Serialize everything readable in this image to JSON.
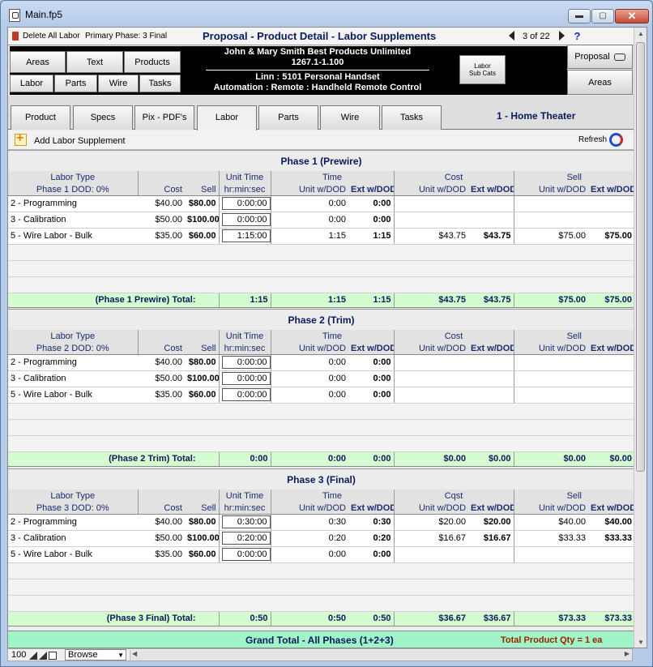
{
  "window": {
    "title": "Main.fp5",
    "min_glyph": "▬",
    "max_glyph": "▢",
    "close_glyph": "✕"
  },
  "topbar": {
    "delete_all": "Delete All Labor",
    "primary_phase": "Primary Phase: 3 Final",
    "page_title": "Proposal - Product Detail - Labor Supplements",
    "record_count": "3 of 22",
    "help": "?"
  },
  "nav": {
    "areas": "Areas",
    "text": "Text",
    "products": "Products",
    "labor": "Labor",
    "parts": "Parts",
    "wire": "Wire",
    "tasks": "Tasks",
    "client_line1": "John & Mary Smith  Best Products Unlimited",
    "client_line2": "1267.1-1.100",
    "product_line1": "Linn : 5101 Personal Handset",
    "product_line2": "Automation : Remote : Handheld Remote Control",
    "subcats_line1": "Labor",
    "subcats_line2": "Sub Cats",
    "proposal": "Proposal",
    "areas_right": "Areas"
  },
  "tabs": [
    {
      "label": "Product"
    },
    {
      "label": "Specs"
    },
    {
      "label": "Pix - PDF's"
    },
    {
      "label": "Labor"
    },
    {
      "label": "Parts"
    },
    {
      "label": "Wire"
    },
    {
      "label": "Tasks"
    }
  ],
  "area_name": "1 - Home Theater",
  "add_supplement": "Add Labor Supplement",
  "refresh": "Refresh",
  "headers": {
    "labor_type": "Labor Type",
    "cost": "Cost",
    "sell": "Sell",
    "unit_time": "Unit Time",
    "hms": "hr:min:sec",
    "time": "Time",
    "unit_dod": "Unit w/DOD",
    "ext_dod": "Ext w/DOD",
    "cost_group": "Cost",
    "sell_group": "Sell"
  },
  "phases": [
    {
      "title": "Phase 1 (Prewire)",
      "dod": "Phase 1 DOD: 0%",
      "cost_group": "Cost",
      "rows": [
        {
          "type": "2 - Programming",
          "cost": "$40.00",
          "sell": "$80.00",
          "unit_time": "0:00:00",
          "time_unit": "0:00",
          "time_ext": "0:00",
          "cost_unit": "",
          "cost_ext": "",
          "sell_unit": "",
          "sell_ext": ""
        },
        {
          "type": "3 - Calibration",
          "cost": "$50.00",
          "sell": "$100.00",
          "unit_time": "0:00:00",
          "time_unit": "0:00",
          "time_ext": "0:00",
          "cost_unit": "",
          "cost_ext": "",
          "sell_unit": "",
          "sell_ext": ""
        },
        {
          "type": "5 - Wire Labor - Bulk",
          "cost": "$35.00",
          "sell": "$60.00",
          "unit_time": "1:15:00",
          "time_unit": "1:15",
          "time_ext": "1:15",
          "cost_unit": "$43.75",
          "cost_ext": "$43.75",
          "sell_unit": "$75.00",
          "sell_ext": "$75.00"
        }
      ],
      "total": {
        "label": "(Phase 1 Prewire) Total:",
        "unit_time": "1:15",
        "time_unit": "1:15",
        "time_ext": "1:15",
        "cost_unit": "$43.75",
        "cost_ext": "$43.75",
        "sell_unit": "$75.00",
        "sell_ext": "$75.00"
      }
    },
    {
      "title": "Phase 2 (Trim)",
      "dod": "Phase 2 DOD: 0%",
      "cost_group": "Cost",
      "rows": [
        {
          "type": "2 - Programming",
          "cost": "$40.00",
          "sell": "$80.00",
          "unit_time": "0:00:00",
          "time_unit": "0:00",
          "time_ext": "0:00",
          "cost_unit": "",
          "cost_ext": "",
          "sell_unit": "",
          "sell_ext": ""
        },
        {
          "type": "3 - Calibration",
          "cost": "$50.00",
          "sell": "$100.00",
          "unit_time": "0:00:00",
          "time_unit": "0:00",
          "time_ext": "0:00",
          "cost_unit": "",
          "cost_ext": "",
          "sell_unit": "",
          "sell_ext": ""
        },
        {
          "type": "5 - Wire Labor - Bulk",
          "cost": "$35.00",
          "sell": "$60.00",
          "unit_time": "0:00:00",
          "time_unit": "0:00",
          "time_ext": "0:00",
          "cost_unit": "",
          "cost_ext": "",
          "sell_unit": "",
          "sell_ext": ""
        }
      ],
      "total": {
        "label": "(Phase 2 Trim) Total:",
        "unit_time": "0:00",
        "time_unit": "0:00",
        "time_ext": "0:00",
        "cost_unit": "$0.00",
        "cost_ext": "$0.00",
        "sell_unit": "$0.00",
        "sell_ext": "$0.00"
      }
    },
    {
      "title": "Phase 3 (Final)",
      "dod": "Phase 3 DOD: 0%",
      "cost_group": "Cqst",
      "rows": [
        {
          "type": "2 - Programming",
          "cost": "$40.00",
          "sell": "$80.00",
          "unit_time": "0:30:00",
          "time_unit": "0:30",
          "time_ext": "0:30",
          "cost_unit": "$20.00",
          "cost_ext": "$20.00",
          "sell_unit": "$40.00",
          "sell_ext": "$40.00"
        },
        {
          "type": "3 - Calibration",
          "cost": "$50.00",
          "sell": "$100.00",
          "unit_time": "0:20:00",
          "time_unit": "0:20",
          "time_ext": "0:20",
          "cost_unit": "$16.67",
          "cost_ext": "$16.67",
          "sell_unit": "$33.33",
          "sell_ext": "$33.33"
        },
        {
          "type": "5 - Wire Labor - Bulk",
          "cost": "$35.00",
          "sell": "$60.00",
          "unit_time": "0:00:00",
          "time_unit": "0:00",
          "time_ext": "0:00",
          "cost_unit": "",
          "cost_ext": "",
          "sell_unit": "",
          "sell_ext": ""
        }
      ],
      "total": {
        "label": "(Phase 3 Final) Total:",
        "unit_time": "0:50",
        "time_unit": "0:50",
        "time_ext": "0:50",
        "cost_unit": "$36.67",
        "cost_ext": "$36.67",
        "sell_unit": "$73.33",
        "sell_ext": "$73.33"
      }
    }
  ],
  "grand_total": {
    "label": "Grand Total  - All Phases (1+2+3)",
    "qty": "Total Product Qty = 1 ea"
  },
  "statusbar": {
    "zoom": "100",
    "mode": "Browse"
  }
}
